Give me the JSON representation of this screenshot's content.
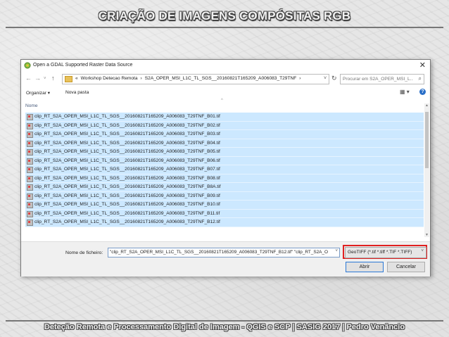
{
  "slide": {
    "title": "CRIAÇÃO DE IMAGENS COMPÓSITAS RGB",
    "footer": "Deteção Remota e Processamento Digital de Imagem - QGIS e SCP   |   SASIG 2017   |   Pedro Venâncio"
  },
  "dialog": {
    "title": "Open a GDAL Supported Raster Data Source",
    "breadcrumbs": [
      "«",
      "Workshop Detecao Remota",
      "›",
      "S2A_OPER_MSI_L1C_TL_SGS__20160821T165209_A006083_T29TNF",
      "›"
    ],
    "search_placeholder": "Procurar em S2A_OPER_MSI_L...",
    "toolbar": {
      "organize": "Organizar ▾",
      "new_folder": "Nova pasta"
    },
    "column_header": "Nome",
    "files": [
      "clip_RT_S2A_OPER_MSI_L1C_TL_SGS__20160821T165209_A006083_T29TNF_B01.tif",
      "clip_RT_S2A_OPER_MSI_L1C_TL_SGS__20160821T165209_A006083_T29TNF_B02.tif",
      "clip_RT_S2A_OPER_MSI_L1C_TL_SGS__20160821T165209_A006083_T29TNF_B03.tif",
      "clip_RT_S2A_OPER_MSI_L1C_TL_SGS__20160821T165209_A006083_T29TNF_B04.tif",
      "clip_RT_S2A_OPER_MSI_L1C_TL_SGS__20160821T165209_A006083_T29TNF_B05.tif",
      "clip_RT_S2A_OPER_MSI_L1C_TL_SGS__20160821T165209_A006083_T29TNF_B06.tif",
      "clip_RT_S2A_OPER_MSI_L1C_TL_SGS__20160821T165209_A006083_T29TNF_B07.tif",
      "clip_RT_S2A_OPER_MSI_L1C_TL_SGS__20160821T165209_A006083_T29TNF_B08.tif",
      "clip_RT_S2A_OPER_MSI_L1C_TL_SGS__20160821T165209_A006083_T29TNF_B8A.tif",
      "clip_RT_S2A_OPER_MSI_L1C_TL_SGS__20160821T165209_A006083_T29TNF_B09.tif",
      "clip_RT_S2A_OPER_MSI_L1C_TL_SGS__20160821T165209_A006083_T29TNF_B10.tif",
      "clip_RT_S2A_OPER_MSI_L1C_TL_SGS__20160821T165209_A006083_T29TNF_B11.tif",
      "clip_RT_S2A_OPER_MSI_L1C_TL_SGS__20160821T165209_A006083_T29TNF_B12.tif"
    ],
    "filename_label": "Nome de ficheiro:",
    "filename_value": "\"clip_RT_S2A_OPER_MSI_L1C_TL_SGS__20160821T165209_A006083_T29TNF_B12.tif\" \"clip_RT_S2A_O",
    "filter_value": "GeoTIFF (*.tif *.tiff *.TIF *.TIFF)",
    "open_button": "Abrir",
    "cancel_button": "Cancelar"
  },
  "colors": {
    "selection": "#cce8ff",
    "highlight": "#e02020",
    "accent": "#2a78d6"
  }
}
